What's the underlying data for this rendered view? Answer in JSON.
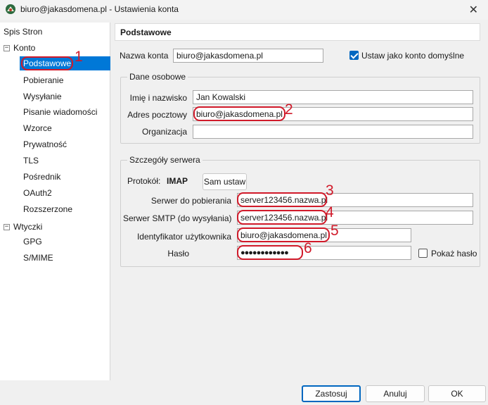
{
  "window": {
    "title": "biuro@jakasdomena.pl - Ustawienia konta",
    "close_glyph": "✕"
  },
  "sidebar": {
    "header": "Spis Stron",
    "groups": [
      {
        "label": "Konto",
        "toggle": "−",
        "items": [
          "Podstawowe",
          "Pobieranie",
          "Wysyłanie",
          "Pisanie wiadomości",
          "Wzorce",
          "Prywatność",
          "TLS",
          "Pośrednik",
          "OAuth2",
          "Rozszerzone"
        ]
      },
      {
        "label": "Wtyczki",
        "toggle": "−",
        "items": [
          "GPG",
          "S/MIME"
        ]
      }
    ],
    "selected": "Podstawowe"
  },
  "panel": {
    "title": "Podstawowe",
    "account_name_label": "Nazwa konta",
    "account_name_value": "biuro@jakasdomena.pl",
    "default_account_label": "Ustaw jako konto domyślne",
    "default_account_checked": true,
    "personal": {
      "title": "Dane osobowe",
      "name_label": "Imię i nazwisko",
      "name_value": "Jan Kowalski",
      "email_label": "Adres pocztowy",
      "email_value": "biuro@jakasdomena.pl",
      "org_label": "Organizacja",
      "org_value": ""
    },
    "server": {
      "title": "Szczegóły serwera",
      "protocol_label": "Protokół:",
      "protocol_value": "IMAP",
      "manual_button": "Sam ustaw",
      "incoming_label": "Serwer do pobierania",
      "incoming_value": "server123456.nazwa.pl",
      "smtp_label": "Serwer SMTP (do wysyłania)",
      "smtp_value": "server123456.nazwa.pl",
      "user_label": "Identyfikator użytkownika",
      "user_value": "biuro@jakasdomena.pl",
      "password_label": "Hasło",
      "password_value": "●●●●●●●●●●●●",
      "show_password_label": "Pokaż hasło",
      "show_password_checked": false
    }
  },
  "buttons": {
    "apply": "Zastosuj",
    "cancel": "Anuluj",
    "ok": "OK"
  },
  "annotations": [
    "1",
    "2",
    "3",
    "4",
    "5",
    "6"
  ],
  "colors": {
    "selection": "#0078d7",
    "annotation": "#d11a2a",
    "checkbox": "#0067c0"
  }
}
